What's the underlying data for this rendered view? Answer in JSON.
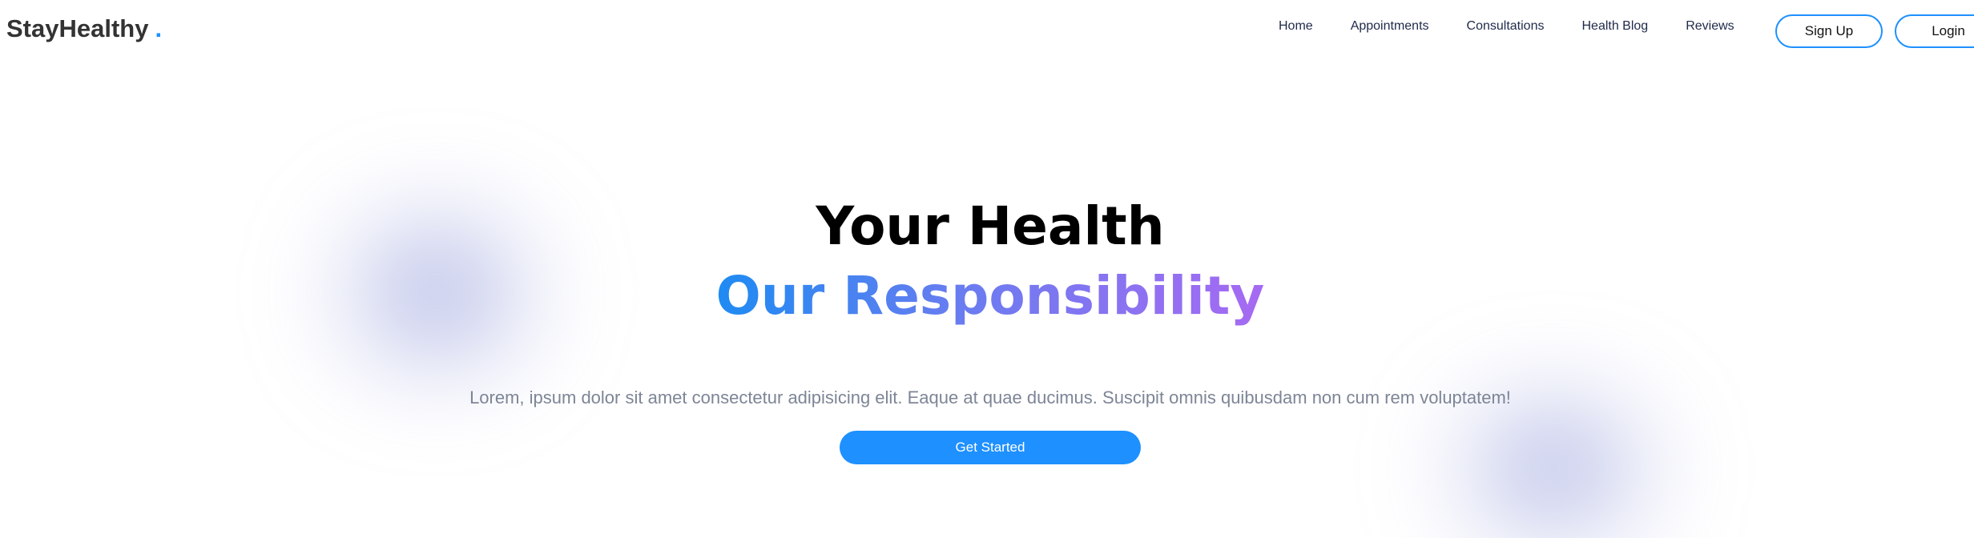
{
  "brand": {
    "name": "StayHealthy",
    "dot": ".",
    "accent_color": "#1e90ff"
  },
  "nav": {
    "links": [
      {
        "label": "Home"
      },
      {
        "label": "Appointments"
      },
      {
        "label": "Consultations"
      },
      {
        "label": "Health Blog"
      },
      {
        "label": "Reviews"
      }
    ],
    "signup_label": "Sign Up",
    "login_label": "Login"
  },
  "hero": {
    "title_line1": "Your Health",
    "title_line2": "Our Responsibility",
    "gradient_colors": [
      "#1e8bf2",
      "#6a7cf0",
      "#a66af2"
    ],
    "description": "Lorem, ipsum dolor sit amet consectetur adipisicing elit. Eaque at quae ducimus. Suscipit omnis quibusdam non cum rem voluptatem!",
    "cta_label": "Get Started"
  }
}
